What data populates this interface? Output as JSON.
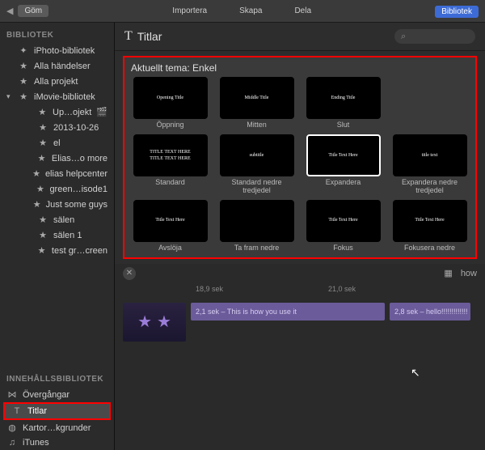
{
  "toolbar": {
    "hide": "Göm",
    "import": "Importera",
    "create": "Skapa",
    "share": "Dela",
    "library": "Bibliotek"
  },
  "sidebar": {
    "library_title": "BIBLIOTEK",
    "content_title": "INNEHÅLLSBIBLIOTEK",
    "lib_items": [
      {
        "label": "iPhoto-bibliotek",
        "icon": "sparkle"
      },
      {
        "label": "Alla händelser",
        "icon": "star"
      },
      {
        "label": "Alla projekt",
        "icon": "star"
      },
      {
        "label": "iMovie-bibliotek",
        "icon": "star",
        "expandable": true
      },
      {
        "label": "Up…ojekt",
        "icon": "star",
        "indent": 2,
        "clap": true
      },
      {
        "label": "2013-10-26",
        "icon": "star",
        "indent": 2
      },
      {
        "label": "el",
        "icon": "star",
        "indent": 2
      },
      {
        "label": "Elias…o more",
        "icon": "star",
        "indent": 2
      },
      {
        "label": "elias helpcenter",
        "icon": "star",
        "indent": 2
      },
      {
        "label": "green…isode1",
        "icon": "star",
        "indent": 2
      },
      {
        "label": "Just some guys",
        "icon": "star",
        "indent": 2
      },
      {
        "label": "sälen",
        "icon": "star",
        "indent": 2
      },
      {
        "label": "sälen 1",
        "icon": "star",
        "indent": 2
      },
      {
        "label": "test gr…creen",
        "icon": "star",
        "indent": 2
      }
    ],
    "content_items": [
      {
        "label": "Övergångar",
        "icon": "bowtie"
      },
      {
        "label": "Titlar",
        "icon": "T",
        "selected": true,
        "highlighted": true
      },
      {
        "label": "Kartor…kgrunder",
        "icon": "globe"
      },
      {
        "label": "iTunes",
        "icon": "note"
      }
    ]
  },
  "content": {
    "header_title": "Titlar",
    "theme_label": "Aktuellt tema: Enkel",
    "titles": [
      {
        "caption": "Öppning",
        "intext": "Opening Title"
      },
      {
        "caption": "Mitten",
        "intext": "Middle Title"
      },
      {
        "caption": "Slut",
        "intext": "Ending Title"
      },
      {
        "caption": "",
        "intext": ""
      },
      {
        "caption": "Standard",
        "intext": "TITLE TEXT HERE\nTITLE TEXT HERE"
      },
      {
        "caption": "Standard nedre tredjedel",
        "intext": "subtitle"
      },
      {
        "caption": "Expandera",
        "intext": "Title Text Here",
        "selected": true
      },
      {
        "caption": "Expandera nedre tredjedel",
        "intext": "title text"
      },
      {
        "caption": "Avslöja",
        "intext": "Title Text Here"
      },
      {
        "caption": "Ta fram nedre",
        "intext": ""
      },
      {
        "caption": "Fokus",
        "intext": "Title Text Here"
      },
      {
        "caption": "Fokusera nedre",
        "intext": "Title Text Here"
      }
    ]
  },
  "timeline": {
    "ruler": [
      "18,9 sek",
      "21,0 sek"
    ],
    "view_label": "how",
    "clip1": "2,1 sek – This is how you use it",
    "clip2": "2,8 sek – hello!!!!!!!!!!!!!"
  }
}
